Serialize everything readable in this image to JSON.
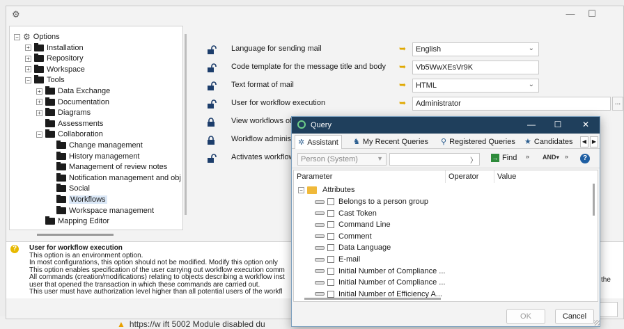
{
  "options_window": {
    "title_controls": {
      "minimize": "—",
      "maximize": "☐"
    },
    "tree": {
      "items": [
        {
          "label": "Options",
          "expander": "⊟",
          "icon": "gear-icon"
        },
        {
          "label": "Installation",
          "expander": "⊞",
          "icon": "folder-icon"
        },
        {
          "label": "Repository",
          "expander": "⊞",
          "icon": "folder-icon"
        },
        {
          "label": "Workspace",
          "expander": "⊞",
          "icon": "folder-icon"
        },
        {
          "label": "Tools",
          "expander": "⊟",
          "icon": "folder-icon"
        },
        {
          "label": "Data Exchange",
          "expander": "⊞",
          "icon": "folder-icon"
        },
        {
          "label": "Documentation",
          "expander": "⊞",
          "icon": "folder-icon"
        },
        {
          "label": "Diagrams",
          "expander": "⊞",
          "icon": "folder-icon"
        },
        {
          "label": "Assessments",
          "expander": "",
          "icon": "folder-icon"
        },
        {
          "label": "Collaboration",
          "expander": "⊟",
          "icon": "folder-icon"
        },
        {
          "label": "Change management",
          "expander": "",
          "icon": "folder-icon"
        },
        {
          "label": "History management",
          "expander": "",
          "icon": "folder-icon"
        },
        {
          "label": "Management of review notes",
          "expander": "",
          "icon": "folder-icon"
        },
        {
          "label": "Notification management and obj",
          "expander": "",
          "icon": "folder-icon"
        },
        {
          "label": "Social",
          "expander": "",
          "icon": "folder-icon"
        },
        {
          "label": "Workflows",
          "expander": "",
          "icon": "folder-icon"
        },
        {
          "label": "Workspace management",
          "expander": "",
          "icon": "folder-icon"
        },
        {
          "label": "Mapping Editor",
          "expander": "",
          "icon": "folder-icon"
        }
      ]
    },
    "settings": [
      {
        "label": "Language for sending mail",
        "lock": "unlocked",
        "value": "English",
        "kind": "dropdown"
      },
      {
        "label": "Code template for the message title and body",
        "lock": "unlocked",
        "value": "Vb5WwXEsVr9K",
        "kind": "text"
      },
      {
        "label": "Text format of mail",
        "lock": "unlocked",
        "value": "HTML",
        "kind": "dropdown"
      },
      {
        "label": "User for workflow execution",
        "lock": "unlocked",
        "value": "Administrator",
        "kind": "text-browse",
        "browse_label": "..."
      },
      {
        "label": "View workflows of all u",
        "lock": "locked",
        "value": "",
        "kind": "checkbox"
      },
      {
        "label": "Workflow administ",
        "lock": "locked",
        "value": "",
        "kind": "none"
      },
      {
        "label": "Activates workflow",
        "lock": "unlocked",
        "value": "",
        "kind": "none"
      }
    ],
    "description": {
      "title": "User for workflow execution",
      "lines": [
        "This option is an environment option.",
        "In most configurations, this option should not be modified. Modify this option only",
        "This option enables specification of the user carrying out workflow execution comm",
        "All commands (creation/modifications) relating to objects describing a workflow inst",
        "user that opened the transaction in which these commands are carried out.",
        "This user must have authorization level higher than all potential users of the workfl"
      ],
      "overflow_word": "the"
    },
    "background_status": "https://w ift 5002 Module disabled du"
  },
  "query_dialog": {
    "title": "Query",
    "controls": {
      "minimize": "—",
      "maximize": "☐",
      "close": "✕"
    },
    "tabs": [
      {
        "label": "Assistant",
        "icon": "assistant-icon",
        "active": true
      },
      {
        "label": "My Recent Queries",
        "icon": "recent-queries-icon",
        "active": false
      },
      {
        "label": "Registered Queries",
        "icon": "search-icon",
        "active": false
      },
      {
        "label": "Candidates",
        "icon": "star-icon",
        "active": false
      }
    ],
    "toolbar": {
      "class_combo": "Person (System)",
      "search_value": "",
      "find_label": "Find",
      "more": "»",
      "and_or": "AND\nOR"
    },
    "grid": {
      "columns": [
        "Parameter",
        "Operator",
        "Value"
      ],
      "root": "Attributes",
      "rows": [
        "Belongs to a person group",
        "Cast Token",
        "Command Line",
        "Comment",
        "Data Language",
        "E-mail",
        "Initial Number of Compliance ...",
        "Initial Number of Compliance ...",
        "Initial Number of Efficiency A..."
      ]
    },
    "buttons": {
      "ok": "OK",
      "cancel": "Cancel"
    }
  }
}
